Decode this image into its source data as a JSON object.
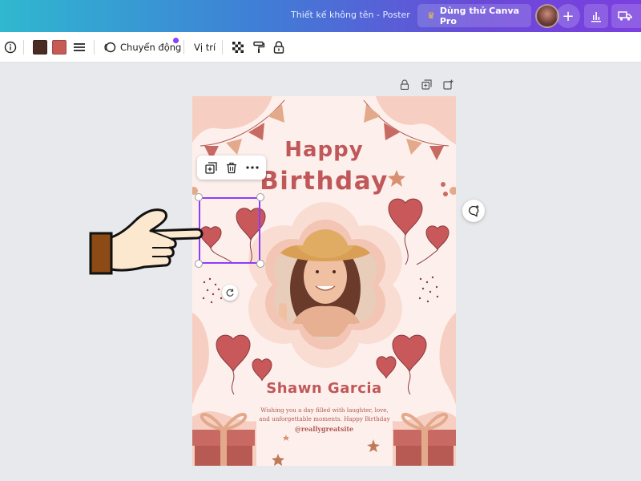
{
  "header": {
    "doc_title": "Thiết kế không tên - Poster",
    "pro_button_label": "Dùng thử Canva Pro",
    "crown_icon": "crown-icon",
    "plus_label": "+"
  },
  "toolbar": {
    "info_icon": "info-icon",
    "colors": [
      "#4a2c25",
      "#c65a55"
    ],
    "motion_label": "Chuyển động",
    "position_label": "Vị trí",
    "icons": [
      "info-icon",
      "line-style-icon",
      "motion-icon",
      "transparency-icon",
      "paint-roller-icon",
      "lock-icon"
    ]
  },
  "poster": {
    "title_line1": "Happy",
    "title_line2": "Birthday",
    "name": "Shawn Garcia",
    "wish_line1": "Wishing you a day filled with laughter, love,",
    "wish_line2": "and unforgettable moments. Happy Birthday",
    "handle": "@reallygreatsite",
    "colors": {
      "background": "#fdf0ec",
      "accent": "#c0585a",
      "peach": "#f6cfc2",
      "bunting": "#c86a63"
    }
  },
  "selection": {
    "element": "balloons",
    "toolbar_icons": [
      "duplicate-icon",
      "trash-icon",
      "more-icon"
    ],
    "accent": "#8b3dff"
  }
}
